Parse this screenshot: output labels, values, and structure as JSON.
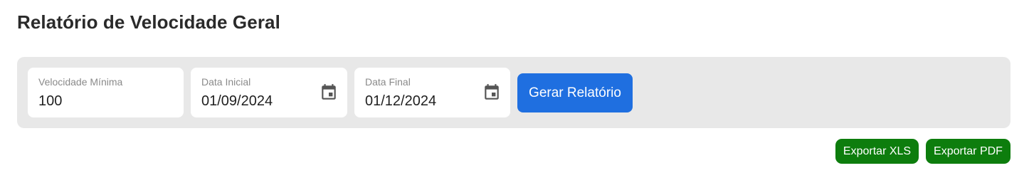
{
  "page": {
    "title": "Relatório de Velocidade Geral"
  },
  "filters": {
    "min_speed": {
      "label": "Velocidade Mínima",
      "value": "100"
    },
    "start_date": {
      "label": "Data Inicial",
      "value": "01/09/2024",
      "icon": "calendar-icon"
    },
    "end_date": {
      "label": "Data Final",
      "value": "01/12/2024",
      "icon": "calendar-icon"
    },
    "generate_label": "Gerar Relatório"
  },
  "exports": {
    "xls_label": "Exportar XLS",
    "pdf_label": "Exportar PDF"
  },
  "colors": {
    "primary": "#1f6fe0",
    "export": "#0d7d0d",
    "panel": "#e8e8e8",
    "icon": "#555555"
  }
}
